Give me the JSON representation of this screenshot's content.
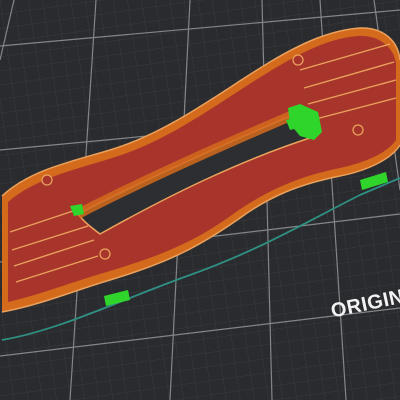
{
  "viewport": {
    "bed_label": "ORIGINAL",
    "colors": {
      "bed": "#2a2b2e",
      "grid_minor": "#3b3c40",
      "grid_major": "#8a8c90",
      "model_perimeter": "#d46a1c",
      "model_infill": "#a8352b",
      "model_edge": "#e9a15d",
      "support": "#2fd52a",
      "skirt": "#2f8f83"
    },
    "icons": {
      "part": "sliced-model",
      "supports": "support-material",
      "skirt": "skirt-outline"
    }
  }
}
